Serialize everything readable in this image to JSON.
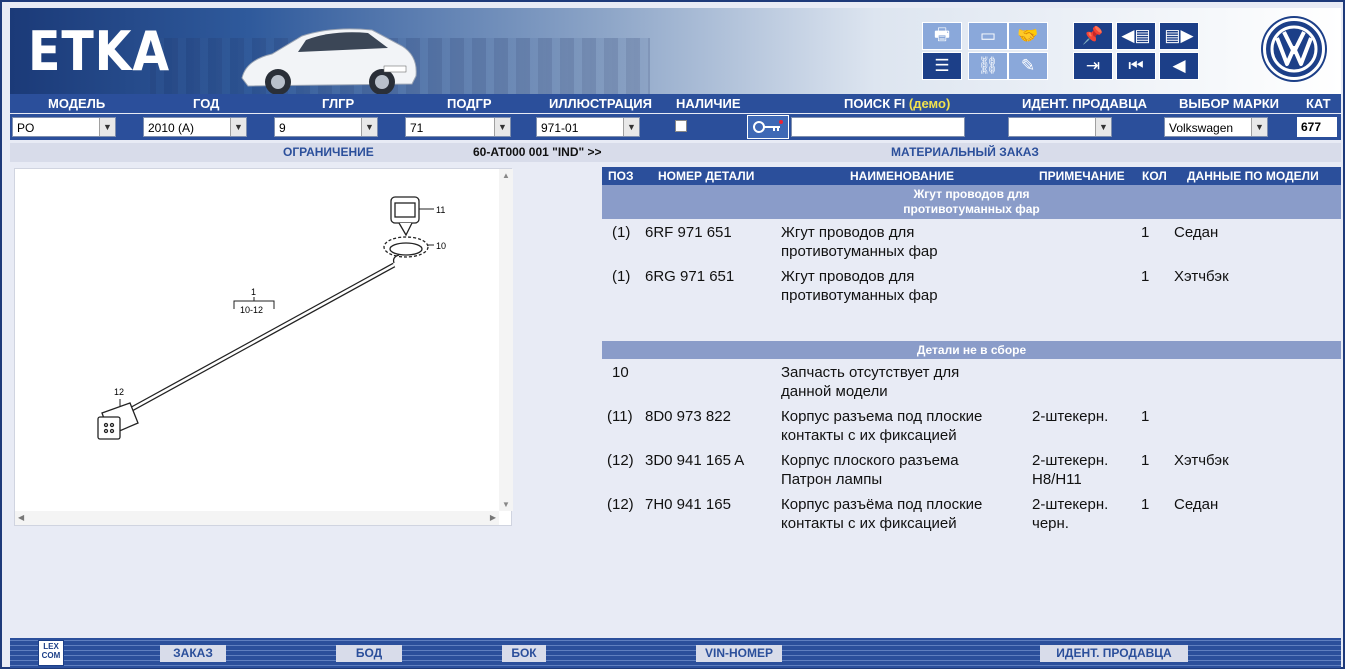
{
  "header": {
    "logo": "ETKA"
  },
  "labels": {
    "model": "МОДЕЛЬ",
    "year": "ГОД",
    "main_group": "ГЛГР",
    "sub_group": "ПОДГР",
    "illustration": "ИЛЛЮСТРАЦИЯ",
    "availability": "НАЛИЧИЕ",
    "search_fi": "ПОИСК FI",
    "search_demo": "(демо)",
    "dealer_id": "ИДЕНТ. ПРОДАВЦА",
    "brand_select": "ВЫБОР МАРКИ",
    "catalog": "КАТ"
  },
  "inputs": {
    "model": "PO",
    "year": "2010 (A)",
    "main_group": "9",
    "sub_group": "71",
    "illustration": "971-01",
    "brand": "Volkswagen",
    "catalog": "677"
  },
  "subheader": {
    "restriction": "ОГРАНИЧЕНИЕ",
    "code": "60-AT000 001 \"IND\" >>",
    "material_order": "МАТЕРИАЛЬНЫЙ ЗАКАЗ"
  },
  "illustration": {
    "callouts": [
      "11",
      "10",
      "1",
      "10-12",
      "12"
    ]
  },
  "table": {
    "headers": {
      "pos": "ПОЗ",
      "part_no": "НОМЕР ДЕТАЛИ",
      "name": "НАИМЕНОВАНИЕ",
      "note": "ПРИМЕЧАНИЕ",
      "qty": "КОЛ",
      "model_data": "ДАННЫЕ ПО МОДЕЛИ"
    },
    "group1": {
      "line1": "Жгут проводов для",
      "line2": "противотуманных фар"
    },
    "rows1": [
      {
        "pos": "(1)",
        "part": "6RF 971 651",
        "name1": "Жгут проводов для",
        "name2": "противотуманных фар",
        "note1": "",
        "note2": "",
        "qty": "1",
        "model": "Седан"
      },
      {
        "pos": "(1)",
        "part": "6RG 971 651",
        "name1": "Жгут проводов для",
        "name2": "противотуманных фар",
        "note1": "",
        "note2": "",
        "qty": "1",
        "model": "Хэтчбэк"
      }
    ],
    "group2": {
      "line1": "Детали не в сборе"
    },
    "rows2": [
      {
        "pos": "10",
        "part": "",
        "name1": "Запчасть отсутствует для",
        "name2": "данной модели",
        "note1": "",
        "note2": "",
        "qty": "",
        "model": ""
      },
      {
        "pos": "(11)",
        "part": "8D0 973 822",
        "name1": "Корпус разъема под плоские",
        "name2": "контакты с их фиксацией",
        "note1": "2-штекерн.",
        "note2": "",
        "qty": "1",
        "model": ""
      },
      {
        "pos": "(12)",
        "part": "3D0 941 165 A",
        "name1": "Корпус плоского разъема",
        "name2": "Патрон лампы",
        "note1": "2-штекерн.",
        "note2": "H8/H11",
        "qty": "1",
        "model": "Хэтчбэк"
      },
      {
        "pos": "(12)",
        "part": "7H0 941 165",
        "name1": "Корпус разъёма под плоские",
        "name2": "контакты с их фиксацией",
        "note1": "2-штекерн.",
        "note2": "черн.",
        "qty": "1",
        "model": "Седан"
      }
    ]
  },
  "footer": {
    "lex1": "LEX",
    "lex2": "COM",
    "order": "ЗАКАЗ",
    "bod": "БОД",
    "bok": "БОК",
    "vin": "VIN-НОМЕР",
    "dealer": "ИДЕНТ. ПРОДАВЦА"
  },
  "colors": {
    "bar": "#2b4f9b",
    "group": "#8a9cc9",
    "background": "#e8ebf5",
    "demo": "#f3e34d"
  }
}
